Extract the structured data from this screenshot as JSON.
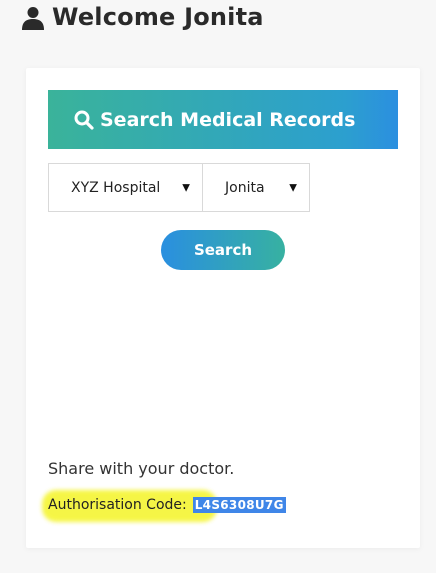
{
  "header": {
    "welcome_text": "Welcome Jonita",
    "user_icon": "user-icon"
  },
  "search_panel": {
    "title": "Search Medical Records",
    "title_icon": "search-icon",
    "hospital_select": {
      "selected": "XYZ Hospital"
    },
    "patient_select": {
      "selected": "Jonita"
    },
    "search_button": "Search"
  },
  "share": {
    "message": "Share with your doctor.",
    "code_label": "Authorisation Code:",
    "code_value": "L4S6308U7G"
  },
  "colors": {
    "gradient_green": "#3ab39a",
    "gradient_blue": "#2b8fe0",
    "highlight_yellow": "#f5f532",
    "code_selection_blue": "#3f86e8"
  }
}
